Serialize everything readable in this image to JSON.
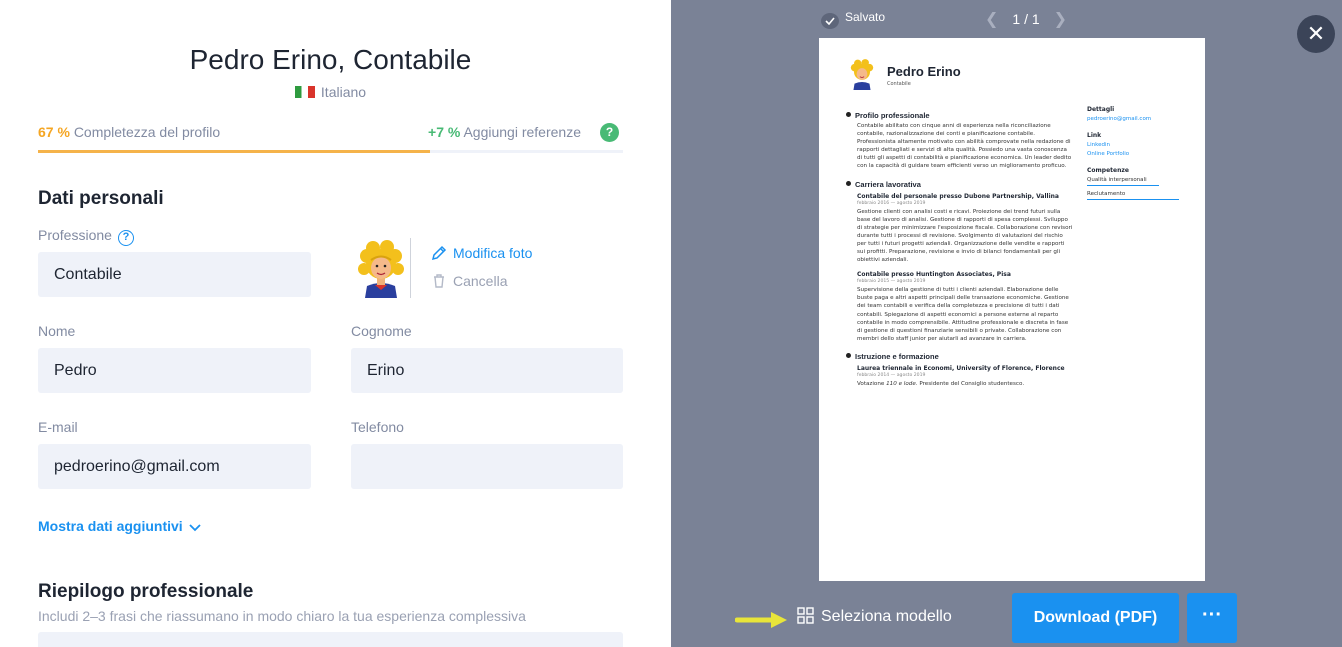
{
  "editor": {
    "title": "Pedro Erino, Contabile",
    "language": "Italiano",
    "progress": {
      "percent_label": "67 %",
      "percent_value": 0.67,
      "completeness_label": "Completezza del profilo",
      "bonus_label": "+7 %",
      "bonus_text": "Aggiungi referenze",
      "help": "?"
    },
    "personal": {
      "title": "Dati personali",
      "profession_label": "Professione",
      "profession_help": "?",
      "profession_value": "Contabile",
      "edit_photo": "Modifica foto",
      "delete_photo": "Cancella",
      "first_name_label": "Nome",
      "first_name_value": "Pedro",
      "last_name_label": "Cognome",
      "last_name_value": "Erino",
      "email_label": "E-mail",
      "email_value": "pedroerino@gmail.com",
      "phone_label": "Telefono",
      "phone_value": "",
      "more_link": "Mostra dati aggiuntivi"
    },
    "summary": {
      "title": "Riepilogo professionale",
      "subtitle": "Includi 2–3 frasi che riassumano in modo chiaro la tua esperienza complessiva"
    }
  },
  "preview": {
    "saved_label": "Salvato",
    "pager": "1 / 1",
    "close": "✕",
    "select_model": "Seleziona modello",
    "download": "Download (PDF)",
    "more": "···",
    "colors": {
      "accent": "#1a91f0",
      "panel": "#7a8296",
      "input_bg": "#eff2f9"
    }
  },
  "resume": {
    "name": "Pedro Erino",
    "role": "Contabile",
    "profile_title": "Profilo professionale",
    "profile_text": "Contabile abilitato con cinque anni di esperienza nella riconciliazione contabile, razionalizzazione dei conti e pianificazione contabile. Professionista altamente motivato con abilità comprovate nella redazione di rapporti dettagliati e servizi di alta qualità. Possiedo una vasta conoscenza di tutti gli aspetti di contabilità e pianificazione economica. Un leader dedito con la capacità di guidare team efficienti verso un miglioramento proficuo.",
    "career_title": "Carriera lavorativa",
    "job1_title": "Contabile del personale presso Dubone Partnership, Vallina",
    "job1_date": "febbraio 2016 — agosto 2019",
    "job1_text": "Gestione clienti con analisi costi e ricavi. Proiezione dei trend futuri sulla base del lavoro di analisi. Gestione di rapporti di spesa complessi. Sviluppo di strategie per minimizzare l'esposizione fiscale. Collaborazione con revisori durante tutti i processi di revisione. Svolgimento di valutazioni del rischio per tutti i futuri progetti aziendali. Organizzazione delle vendite e rapporti sui profitti. Preparazione, revisione e invio di bilanci fondamentali per gli obiettivi aziendali.",
    "job2_title": "Contabile presso Huntington Associates, Pisa",
    "job2_date": "febbraio 2015 — agosto 2019",
    "job2_text": "Supervisione della gestione di tutti i clienti aziendali. Elaborazione delle buste paga e altri aspetti principali delle transazione economiche. Gestione dei team contabili e verifica della completezza e precisione di tutti i dati contabili. Spiegazione di aspetti economici a persone esterne al reparto contabile in modo comprensibile. Attitudine professionale e discreta in fase di gestione di questioni finanziarie sensibili o private. Collaborazione con membri dello staff junior per aiutarli ad avanzare in carriera.",
    "education_title": "Istruzione e formazione",
    "edu_title": "Laurea triennale in Economi, University of Florence, Florence",
    "edu_date": "febbraio 2014 — agosto 2019",
    "edu_text_prefix": "Votazione ",
    "edu_text_italic": "110 e lode",
    "edu_text_suffix": ". Presidente del Consiglio studentesco.",
    "details_title": "Dettagli",
    "email": "pedroerino@gmail.com",
    "links_title": "Link",
    "link1": "Linkedin",
    "link2": "Online Portfolio",
    "skills_title": "Competenze",
    "skill1": "Qualità interpersonali",
    "skill2": "Reclutamento"
  }
}
